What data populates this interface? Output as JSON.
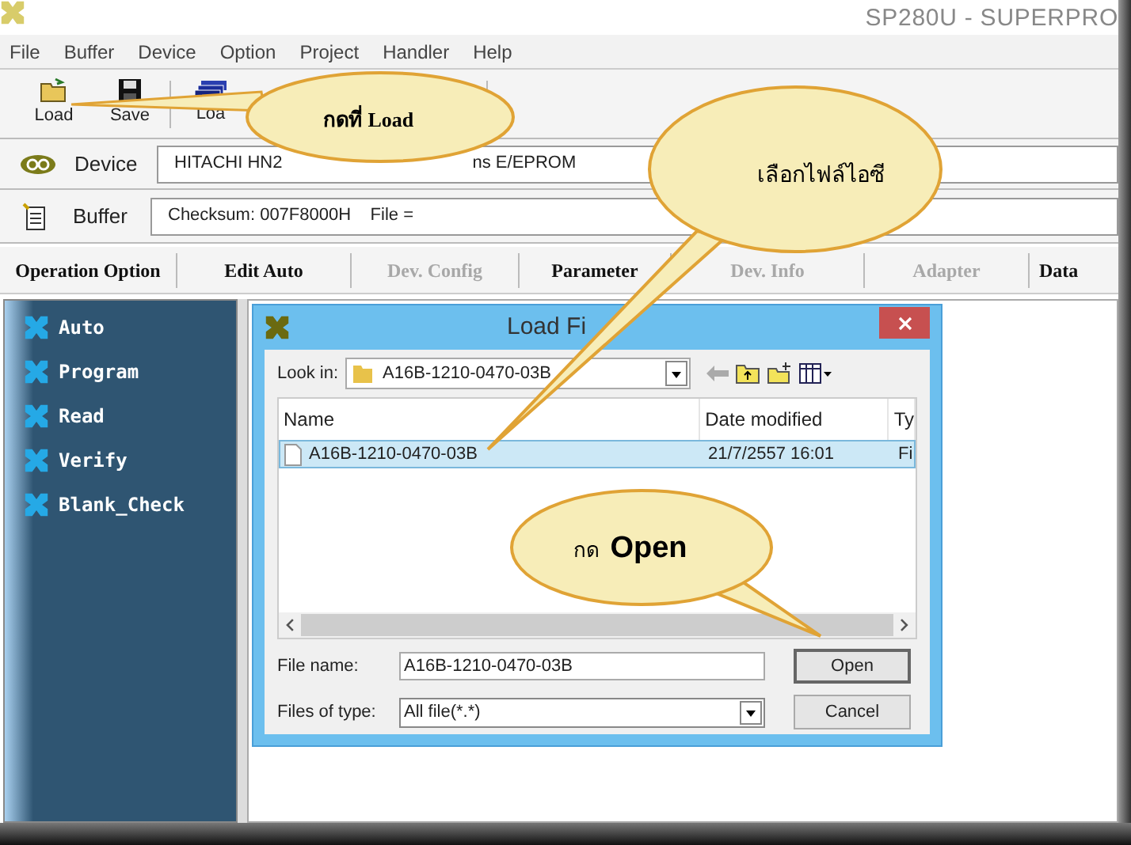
{
  "window": {
    "title": "SP280U - SUPERPRO"
  },
  "menu": [
    "File",
    "Buffer",
    "Device",
    "Option",
    "Project",
    "Handler",
    "Help"
  ],
  "toolbar": [
    {
      "label": "Load",
      "kind": "open"
    },
    {
      "label": "Save",
      "kind": "save"
    },
    {
      "label": "Loa",
      "kind": "stack"
    }
  ],
  "device": {
    "label": "Device",
    "value_start": "HITACHI  HN2",
    "value_end": "ns  E/EPROM"
  },
  "buffer": {
    "label": "Buffer",
    "value": "Checksum: 007F8000H    File ="
  },
  "tabs": [
    {
      "label": "Operation Option",
      "disabled": false
    },
    {
      "label": "Edit Auto",
      "disabled": false
    },
    {
      "label": "Dev. Config",
      "disabled": true
    },
    {
      "label": "Parameter",
      "disabled": false
    },
    {
      "label": "Dev. Info",
      "disabled": true
    },
    {
      "label": "Adapter",
      "disabled": true
    },
    {
      "label": "Data",
      "disabled": false
    }
  ],
  "sidebar": {
    "items": [
      "Auto",
      "Program",
      "Read",
      "Verify",
      "Blank_Check"
    ]
  },
  "dialog": {
    "title": "Load Fi",
    "look_in_label": "Look in:",
    "look_in_value": "A16B-1210-0470-03B",
    "columns": [
      "Name",
      "Date modified",
      "Ty"
    ],
    "files": [
      {
        "name": "A16B-1210-0470-03B",
        "date": "21/7/2557 16:01",
        "type": "Fi",
        "selected": true
      }
    ],
    "file_name_label": "File name:",
    "file_name_value": "A16B-1210-0470-03B",
    "file_type_label": "Files of type:",
    "file_type_value": "All file(*.*)",
    "buttons": [
      "Open",
      "Cancel"
    ]
  },
  "callouts": [
    {
      "text": "กดที่ Load"
    },
    {
      "text": "เลือกไฟล์ไอซี"
    },
    {
      "text": "กด  **Open**"
    }
  ]
}
